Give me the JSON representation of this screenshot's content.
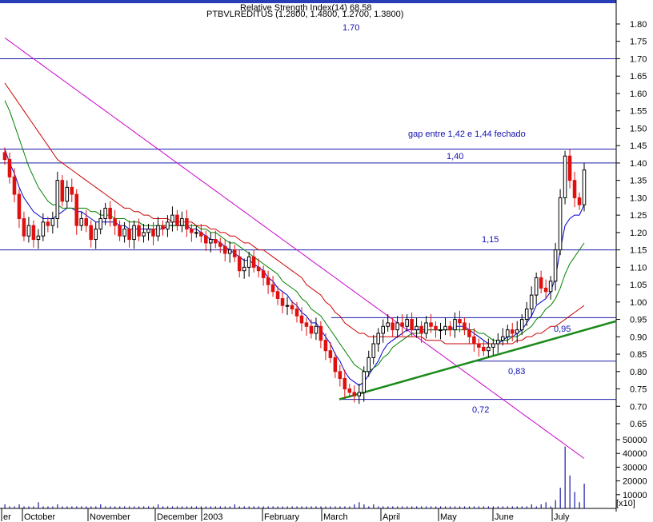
{
  "header": {
    "indicator_label": "Relative Strength Index(14) 68.58",
    "title": "PTBVLREDITUS (1.2800, 1.4800, 1.2700, 1.3800)"
  },
  "chart_data": {
    "type": "candlestick",
    "ticker": "PTBVLREDITUS",
    "last_ohlc": [
      1.28,
      1.48,
      1.27,
      1.38
    ],
    "ylim": [
      0.6,
      1.85
    ],
    "y_ticks": [
      "0.65",
      "0.70",
      "0.75",
      "0.80",
      "0.85",
      "0.90",
      "0.95",
      "1.00",
      "1.05",
      "1.10",
      "1.15",
      "1.20",
      "1.25",
      "1.30",
      "1.35",
      "1.40",
      "1.45",
      "1.50",
      "1.55",
      "1.60",
      "1.65",
      "1.70",
      "1.75",
      "1.80"
    ],
    "volume_ticks": [
      "10000",
      "20000",
      "30000",
      "40000",
      "50000"
    ],
    "volume_unit": "x10",
    "x_labels": [
      "er",
      "October",
      "November",
      "December",
      "2003",
      "February",
      "March",
      "April",
      "May",
      "June",
      "July"
    ],
    "levels": [
      {
        "value": 1.7,
        "label": "1.70"
      },
      {
        "value": 1.44,
        "label": "gap entre 1,42 e 1,44 fechado"
      },
      {
        "value": 1.4,
        "label": "1,40"
      },
      {
        "value": 1.15,
        "label": "1,15"
      },
      {
        "value": 0.955,
        "label": "0,95"
      },
      {
        "value": 0.83,
        "label": "0,83"
      },
      {
        "value": 0.72,
        "label": "0,72"
      }
    ],
    "trendline": {
      "from": 0.72,
      "to": 0.945
    },
    "closes": [
      1.41,
      1.36,
      1.31,
      1.24,
      1.19,
      1.22,
      1.18,
      1.19,
      1.23,
      1.22,
      1.24,
      1.35,
      1.29,
      1.33,
      1.31,
      1.22,
      1.24,
      1.22,
      1.18,
      1.21,
      1.24,
      1.27,
      1.24,
      1.22,
      1.19,
      1.21,
      1.18,
      1.22,
      1.19,
      1.2,
      1.21,
      1.19,
      1.22,
      1.21,
      1.23,
      1.25,
      1.22,
      1.24,
      1.21,
      1.2,
      1.2,
      1.19,
      1.17,
      1.18,
      1.17,
      1.16,
      1.14,
      1.15,
      1.13,
      1.09,
      1.1,
      1.13,
      1.1,
      1.09,
      1.07,
      1.05,
      1.03,
      1.01,
      0.99,
      0.99,
      0.98,
      0.96,
      0.94,
      0.93,
      0.91,
      0.93,
      0.89,
      0.86,
      0.84,
      0.8,
      0.78,
      0.75,
      0.74,
      0.73,
      0.74,
      0.8,
      0.84,
      0.88,
      0.91,
      0.93,
      0.94,
      0.92,
      0.94,
      0.93,
      0.95,
      0.92,
      0.93,
      0.91,
      0.94,
      0.93,
      0.92,
      0.92,
      0.93,
      0.92,
      0.95,
      0.94,
      0.92,
      0.9,
      0.88,
      0.87,
      0.86,
      0.87,
      0.88,
      0.89,
      0.9,
      0.92,
      0.91,
      0.92,
      0.95,
      0.98,
      1.02,
      1.07,
      1.04,
      1.03,
      1.06,
      1.15,
      1.3,
      1.42,
      1.35,
      1.3,
      1.28,
      1.38
    ],
    "moving_averages": [
      {
        "color": "#0000cc",
        "values": [
          1.44,
          1.4,
          1.37,
          1.33,
          1.3,
          1.28,
          1.26,
          1.25,
          1.24,
          1.24,
          1.24,
          1.25,
          1.26,
          1.27,
          1.27,
          1.26,
          1.26,
          1.25,
          1.24,
          1.23,
          1.23,
          1.23,
          1.23,
          1.23,
          1.22,
          1.22,
          1.21,
          1.21,
          1.21,
          1.21,
          1.21,
          1.21,
          1.21,
          1.21,
          1.22,
          1.22,
          1.22,
          1.22,
          1.22,
          1.21,
          1.21,
          1.2,
          1.19,
          1.18,
          1.18,
          1.17,
          1.16,
          1.15,
          1.14,
          1.13,
          1.12,
          1.12,
          1.11,
          1.1,
          1.09,
          1.07,
          1.06,
          1.04,
          1.03,
          1.02,
          1.0,
          0.99,
          0.97,
          0.96,
          0.94,
          0.94,
          0.92,
          0.9,
          0.88,
          0.85,
          0.83,
          0.8,
          0.78,
          0.77,
          0.76,
          0.77,
          0.79,
          0.81,
          0.83,
          0.86,
          0.88,
          0.89,
          0.9,
          0.91,
          0.92,
          0.92,
          0.92,
          0.92,
          0.92,
          0.92,
          0.92,
          0.92,
          0.92,
          0.92,
          0.93,
          0.93,
          0.93,
          0.92,
          0.91,
          0.9,
          0.89,
          0.88,
          0.88,
          0.88,
          0.89,
          0.9,
          0.9,
          0.91,
          0.92,
          0.94,
          0.96,
          0.99,
          1.0,
          1.01,
          1.03,
          1.07,
          1.15,
          1.22,
          1.24,
          1.25,
          1.25,
          1.28
        ]
      },
      {
        "color": "#008000",
        "values": [
          1.58,
          1.55,
          1.51,
          1.47,
          1.43,
          1.39,
          1.36,
          1.33,
          1.31,
          1.29,
          1.28,
          1.28,
          1.27,
          1.27,
          1.27,
          1.27,
          1.27,
          1.27,
          1.26,
          1.26,
          1.25,
          1.25,
          1.25,
          1.24,
          1.24,
          1.24,
          1.23,
          1.23,
          1.23,
          1.22,
          1.22,
          1.22,
          1.22,
          1.22,
          1.22,
          1.22,
          1.22,
          1.22,
          1.22,
          1.22,
          1.22,
          1.21,
          1.21,
          1.2,
          1.2,
          1.19,
          1.18,
          1.17,
          1.17,
          1.16,
          1.15,
          1.14,
          1.13,
          1.12,
          1.11,
          1.1,
          1.09,
          1.08,
          1.06,
          1.05,
          1.04,
          1.03,
          1.01,
          1.0,
          0.98,
          0.97,
          0.96,
          0.94,
          0.92,
          0.9,
          0.88,
          0.86,
          0.84,
          0.82,
          0.81,
          0.8,
          0.8,
          0.81,
          0.82,
          0.84,
          0.85,
          0.87,
          0.88,
          0.89,
          0.9,
          0.91,
          0.91,
          0.91,
          0.92,
          0.92,
          0.92,
          0.92,
          0.92,
          0.92,
          0.92,
          0.92,
          0.92,
          0.92,
          0.92,
          0.91,
          0.91,
          0.9,
          0.89,
          0.89,
          0.89,
          0.89,
          0.9,
          0.9,
          0.91,
          0.92,
          0.93,
          0.95,
          0.96,
          0.98,
          0.99,
          1.01,
          1.04,
          1.08,
          1.11,
          1.13,
          1.15,
          1.17
        ]
      },
      {
        "color": "#cc0000",
        "values": [
          1.63,
          1.61,
          1.59,
          1.57,
          1.55,
          1.53,
          1.51,
          1.49,
          1.47,
          1.45,
          1.43,
          1.41,
          1.4,
          1.39,
          1.38,
          1.37,
          1.36,
          1.35,
          1.34,
          1.33,
          1.32,
          1.31,
          1.3,
          1.29,
          1.28,
          1.27,
          1.27,
          1.26,
          1.26,
          1.25,
          1.25,
          1.24,
          1.24,
          1.24,
          1.24,
          1.23,
          1.23,
          1.23,
          1.23,
          1.23,
          1.22,
          1.22,
          1.22,
          1.21,
          1.21,
          1.2,
          1.2,
          1.19,
          1.19,
          1.18,
          1.17,
          1.17,
          1.16,
          1.15,
          1.15,
          1.14,
          1.13,
          1.12,
          1.11,
          1.1,
          1.09,
          1.08,
          1.07,
          1.05,
          1.04,
          1.03,
          1.02,
          1.0,
          0.99,
          0.97,
          0.96,
          0.94,
          0.93,
          0.92,
          0.91,
          0.91,
          0.9,
          0.9,
          0.9,
          0.9,
          0.9,
          0.9,
          0.9,
          0.9,
          0.9,
          0.9,
          0.9,
          0.9,
          0.89,
          0.89,
          0.89,
          0.89,
          0.88,
          0.88,
          0.88,
          0.88,
          0.88,
          0.88,
          0.88,
          0.88,
          0.88,
          0.88,
          0.88,
          0.88,
          0.88,
          0.88,
          0.88,
          0.89,
          0.89,
          0.9,
          0.9,
          0.91,
          0.91,
          0.92,
          0.93,
          0.93,
          0.94,
          0.95,
          0.96,
          0.97,
          0.98,
          0.99
        ]
      },
      {
        "color": "#cc00cc",
        "values": [
          1.76,
          1.75,
          1.74,
          1.73,
          1.72,
          1.71,
          1.7,
          1.69,
          1.68,
          1.67,
          1.66,
          1.65,
          1.64,
          1.63,
          1.62,
          1.61,
          1.6,
          1.59,
          1.58,
          1.57,
          1.56,
          1.55,
          1.54,
          1.53,
          1.52,
          1.51,
          1.5,
          1.49,
          1.48,
          1.47,
          1.46,
          1.45,
          1.44,
          1.43,
          1.42,
          1.41,
          1.4,
          1.39,
          1.38,
          1.37,
          1.36,
          1.35,
          1.34,
          1.33,
          1.32,
          1.31,
          1.3,
          1.29,
          1.28,
          1.27,
          1.26,
          1.25,
          1.24,
          1.23,
          1.22,
          1.21,
          1.2,
          1.19,
          1.18,
          1.17,
          1.16,
          1.15,
          1.14,
          1.13,
          1.12,
          1.11,
          1.1,
          1.09,
          1.08,
          1.07,
          1.06,
          1.05,
          1.04,
          1.03,
          1.02,
          1.01,
          1.0,
          0.99,
          0.98,
          0.97,
          0.96,
          0.95,
          0.94,
          0.93,
          0.92,
          0.91,
          0.9,
          0.89,
          0.88,
          0.87,
          0.86,
          0.85,
          0.84,
          0.83,
          0.82,
          0.81,
          0.8,
          0.79,
          0.78,
          0.77,
          0.76,
          0.75,
          0.74,
          0.73,
          0.72,
          0.71,
          0.7,
          0.69,
          0.68,
          0.67,
          0.66,
          0.65,
          0.64,
          0.63,
          0.62,
          0.61,
          0.6,
          0.59,
          0.58,
          0.57,
          0.56,
          0.55
        ]
      }
    ],
    "volume": [
      2,
      1,
      1,
      2,
      1,
      1,
      1,
      3,
      1,
      1,
      1,
      2,
      1,
      1,
      1,
      1,
      1,
      1,
      1,
      1,
      2,
      1,
      1,
      1,
      1,
      1,
      1,
      1,
      1,
      1,
      1,
      1,
      2,
      1,
      1,
      1,
      1,
      1,
      1,
      1,
      1,
      1,
      1,
      1,
      1,
      1,
      1,
      1,
      2,
      1,
      1,
      1,
      1,
      1,
      1,
      1,
      1,
      1,
      1,
      1,
      1,
      1,
      1,
      1,
      1,
      1,
      1,
      1,
      1,
      1,
      1,
      1,
      1,
      2,
      3,
      2,
      1,
      2,
      1,
      1,
      1,
      1,
      1,
      1,
      1,
      1,
      1,
      1,
      1,
      1,
      1,
      1,
      1,
      1,
      1,
      1,
      1,
      1,
      1,
      1,
      1,
      1,
      1,
      1,
      1,
      1,
      1,
      1,
      1,
      1,
      2,
      1,
      2,
      3,
      1,
      4,
      10,
      30,
      16,
      8,
      3,
      12
    ]
  }
}
